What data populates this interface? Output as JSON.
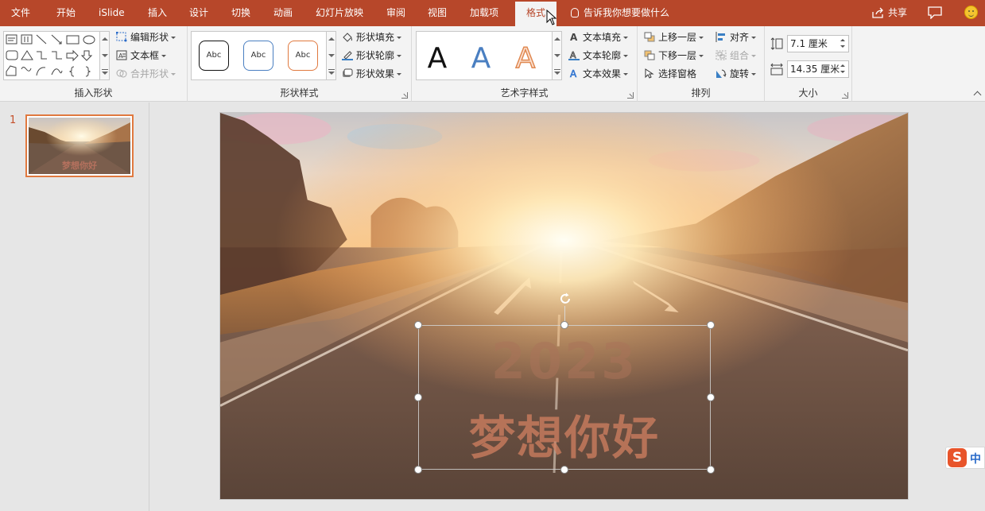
{
  "tabs": [
    {
      "label": "文件",
      "key": "file"
    },
    {
      "label": "开始",
      "key": "home"
    },
    {
      "label": "iSlide",
      "key": "islide"
    },
    {
      "label": "插入",
      "key": "insert"
    },
    {
      "label": "设计",
      "key": "design"
    },
    {
      "label": "切换",
      "key": "transitions"
    },
    {
      "label": "动画",
      "key": "animations"
    },
    {
      "label": "幻灯片放映",
      "key": "slideshow"
    },
    {
      "label": "审阅",
      "key": "review"
    },
    {
      "label": "视图",
      "key": "view"
    },
    {
      "label": "加载项",
      "key": "addins"
    },
    {
      "label": "格式",
      "key": "format",
      "active": true
    }
  ],
  "tell_me": "告诉我你想要做什么",
  "share_label": "共享",
  "ribbon": {
    "insert_shapes": {
      "label": "插入形状",
      "edit_shape": "编辑形状",
      "text_box": "文本框",
      "merge_shapes": "合并形状"
    },
    "shape_styles": {
      "label": "形状样式",
      "presets": [
        "Abc",
        "Abc",
        "Abc"
      ],
      "fill": "形状填充",
      "outline": "形状轮廓",
      "effects": "形状效果"
    },
    "wordart_styles": {
      "label": "艺术字样式",
      "presets": [
        "A",
        "A",
        "A"
      ],
      "text_fill": "文本填充",
      "text_outline": "文本轮廓",
      "text_effects": "文本效果"
    },
    "arrange": {
      "label": "排列",
      "bring_forward": "上移一层",
      "send_backward": "下移一层",
      "selection_pane": "选择窗格",
      "align": "对齐",
      "group": "组合",
      "rotate": "旋转"
    },
    "size": {
      "label": "大小",
      "height": "7.1 厘米",
      "width": "14.35 厘米"
    }
  },
  "slides": [
    {
      "number": "1",
      "thumb_title": "梦想你好"
    }
  ],
  "slide": {
    "year": "2023",
    "title": "梦想你好"
  },
  "ime": {
    "label": "中"
  },
  "colors": {
    "accent": "#b7472a",
    "selected_thumb": "#e0793f",
    "ribbon_bg": "#f3f3f3",
    "workspace_bg": "#e6e6e6"
  }
}
